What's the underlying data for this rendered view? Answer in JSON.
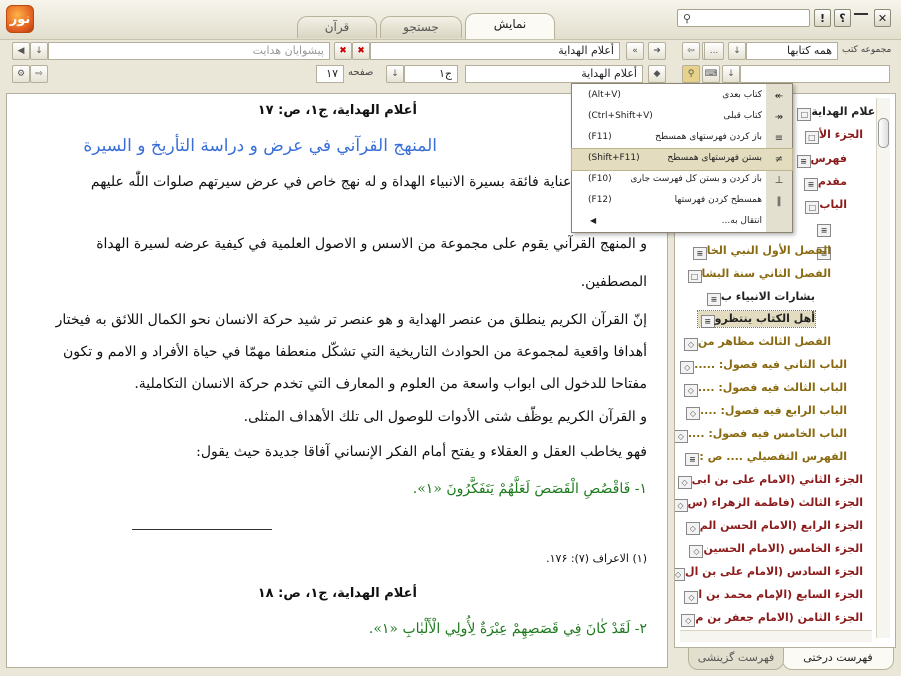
{
  "app": {
    "logo_text": "نور"
  },
  "tabs": [
    {
      "label": "قرآن",
      "active": false
    },
    {
      "label": "جستجو",
      "active": false
    },
    {
      "label": "نمایش",
      "active": true
    }
  ],
  "window": {
    "close": "✕",
    "help": "؟",
    "info": "!"
  },
  "left_toolbar": {
    "book_field": "أعلام الهداية",
    "author_placeholder": "پیشوایان هدایت",
    "volume_value": "ج۱",
    "page_label": "صفحه",
    "page_value": "۱۷",
    "book_field2": "أعلام الهداية"
  },
  "right_toolbar": {
    "collection_label": "مجموعه کتب",
    "collection_value": "همه کتابها",
    "more": "..."
  },
  "content": {
    "p1_header": "أعلام الهداية، ج۱، ص: ۱۷",
    "title": "المنهج القرآني في عرض و دراسة التأريخ و السيرة",
    "l1": "للقرآن الكريم عناية فائقة بسيرة الانبياء الهداة و له نهج خاص في عرض سيرتهم صلوات اللّٰه عليهم",
    "l2": "و المنهج القرآني يقوم على مجموعة من الاسس و الاصول العلمية في كيفية عرضه لسيرة الهداة",
    "l3": "المصطفين.",
    "l4": "إنّ القرآن الكريم ينطلق من عنصر الهداية و هو عنصر تر شيد حركة الانسان نحو الكمال اللائق به فيختار",
    "l5": "أهدافا واقعية لمجموعة من الحوادث التاريخية التي تشكّل منعطفا مهمّا في حياة الأفراد و الامم و تكون",
    "l6": "مفتاحا للدخول الى ابواب واسعة من العلوم و المعارف التي تخدم حركة الانسان التكاملية.",
    "l7": "و القرآن الكريم يوظّف شتى الأدوات للوصول الى تلك الأهداف المثلى.",
    "l8": "فهو يخاطب العقل و العقلاء و يفتح أمام الفكر الإنساني آفاقا جديدة حيث يقول:",
    "a1": "۱- فَاقْصُصِ الْقَصَصَ لَعَلَّهُمْ يَتَفَكَّرُونَ «۱».",
    "footnote": "(۱) الاعراف (۷): ۱۷۶.",
    "p2_header": "أعلام الهداية، ج۱، ص: ۱۸",
    "a2": "۲- لَقَدْ كٰانَ فِي قَصَصِهِمْ عِبْرَةٌ لِأُولِي الْأَلْبٰابِ «۱»."
  },
  "tree": [
    {
      "label": "أعلام الهداية",
      "color": "dark"
    },
    {
      "label": "الجزء الأ",
      "color": "red"
    },
    {
      "label": "فهرس",
      "color": "red"
    },
    {
      "label": "مقدم",
      "color": "red"
    },
    {
      "label": "الباب",
      "color": "red"
    },
    {
      "label": "",
      "color": "red"
    },
    {
      "label": "",
      "color": "red"
    },
    {
      "label": "الفصل الأول النبي الخا",
      "color": "olive"
    },
    {
      "label": "الفصل الثاني سنة البشا",
      "color": "olive"
    },
    {
      "label": "بشارات الانبياء ب",
      "color": "dark"
    },
    {
      "label": "أهل الكتاب ينتظرو",
      "color": "dark"
    },
    {
      "label": "الفصل الثالث مظاهر من",
      "color": "olive"
    },
    {
      "label": "الباب الثاني فيه فصول: .....",
      "color": "olive"
    },
    {
      "label": "الباب الثالث فيه فصول: ....",
      "color": "olive"
    },
    {
      "label": "الباب الرابع فيه فصول: ....",
      "color": "olive"
    },
    {
      "label": "الباب الخامس فيه فصول: ....",
      "color": "olive"
    },
    {
      "label": "الفهرس التفصيلي .... ص :",
      "color": "olive"
    },
    {
      "label": "الجزء الثاني (الامام على بن ابى",
      "color": "red"
    },
    {
      "label": "الجزء الثالث (فاطمة الزهراء (س",
      "color": "red"
    },
    {
      "label": "الجزء الرابع (الامام الحسن الم",
      "color": "red"
    },
    {
      "label": "الجزء الخامس (الامام الحسين",
      "color": "red"
    },
    {
      "label": "الجزء السادس (الامام على بن ال",
      "color": "red"
    },
    {
      "label": "الجزء السابع (الإمام محمد بن ا",
      "color": "red"
    },
    {
      "label": "الجزء الثامن (الامام جعفر بن م",
      "color": "red"
    }
  ],
  "bottom_tabs": [
    {
      "label": "فهرست درختی",
      "active": true
    },
    {
      "label": "فهرست گزینشی",
      "active": false
    }
  ],
  "menu": [
    {
      "label": "کتاب بعدی",
      "shortcut": "(Alt+V)",
      "icon": "next-book-icon"
    },
    {
      "label": "کتاب قبلی",
      "shortcut": "(Ctrl+Shift+V)",
      "icon": "prev-book-icon"
    },
    {
      "label": "باز کردن فهرستهای همسطح",
      "shortcut": "(F11)",
      "icon": "expand-level-icon"
    },
    {
      "label": "بستن فهرستهای همسطح",
      "shortcut": "(Shift+F11)",
      "icon": "collapse-level-icon"
    },
    {
      "label": "باز کردن و بستن کل فهرست جاری",
      "shortcut": "(F10)",
      "icon": "toggle-all-icon"
    },
    {
      "label": "همسطح کردن فهرستها",
      "shortcut": "(F12)",
      "icon": "flatten-icon"
    },
    {
      "label": "انتقال به...",
      "shortcut": "",
      "icon": "move-icon"
    }
  ]
}
